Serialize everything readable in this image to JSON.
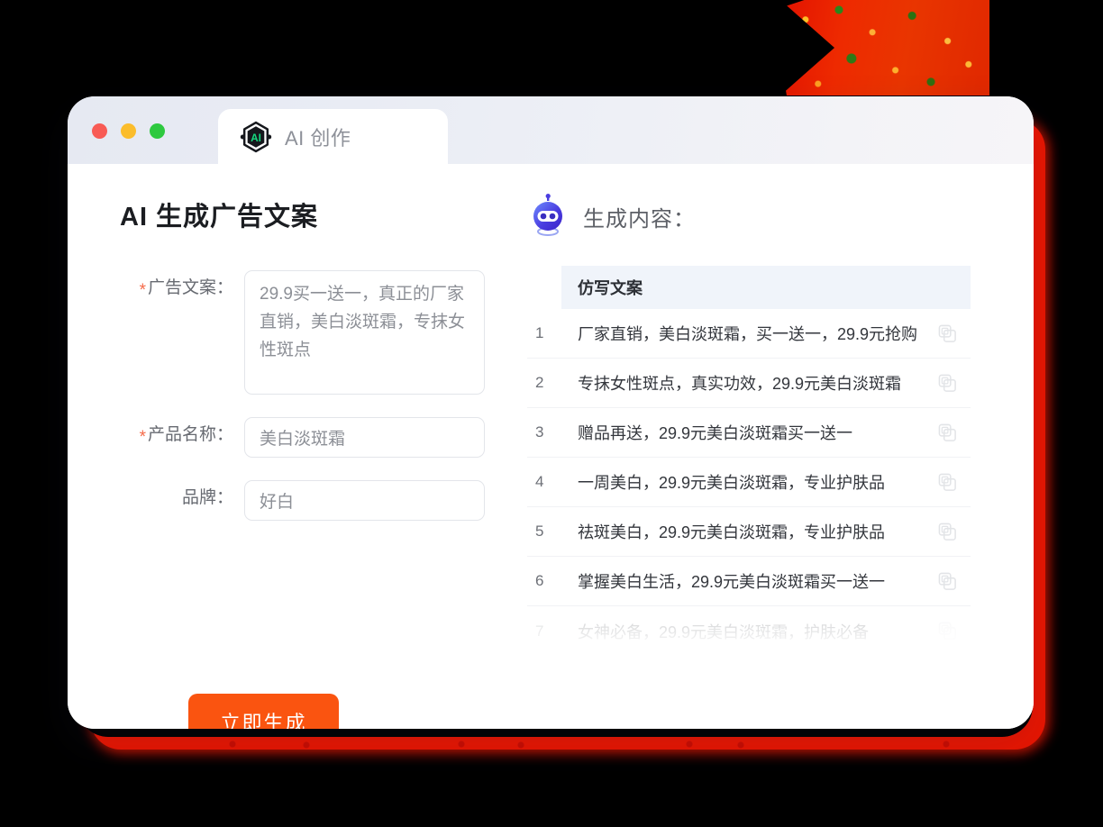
{
  "window": {
    "traffic_lights": [
      {
        "name": "close",
        "color": "#f85b55"
      },
      {
        "name": "minimize",
        "color": "#fbbd2c"
      },
      {
        "name": "maximize",
        "color": "#2ec93f"
      }
    ],
    "tab": {
      "icon": "ai-hexagon-badge-icon",
      "label": "AI 创作"
    }
  },
  "left": {
    "title": "AI 生成广告文案",
    "fields": [
      {
        "label": "广告文案：",
        "required": true,
        "type": "textarea",
        "value": "29.9买一送一，真正的厂家直销，美白淡斑霜，专抹女性斑点"
      },
      {
        "label": "产品名称：",
        "required": true,
        "type": "input",
        "value": "美白淡斑霜"
      },
      {
        "label": "品牌：",
        "required": false,
        "type": "input",
        "value": "好白"
      }
    ],
    "submit_label": "立即生成"
  },
  "right": {
    "icon": "robot-head-icon",
    "title": "生成内容：",
    "table": {
      "header": "仿写文案",
      "row_action_icon": "copy-icon",
      "rows": [
        {
          "num": "1",
          "text": "厂家直销，美白淡斑霜，买一送一，29.9元抢购"
        },
        {
          "num": "2",
          "text": "专抹女性斑点，真实功效，29.9元美白淡斑霜"
        },
        {
          "num": "3",
          "text": "赠品再送，29.9元美白淡斑霜买一送一"
        },
        {
          "num": "4",
          "text": "一周美白，29.9元美白淡斑霜，专业护肤品"
        },
        {
          "num": "5",
          "text": "祛斑美白，29.9元美白淡斑霜，专业护肤品"
        },
        {
          "num": "6",
          "text": "掌握美白生活，29.9元美白淡斑霜买一送一"
        },
        {
          "num": "7",
          "text": "女神必备，29.9元美白淡斑霜，护肤必备"
        }
      ]
    }
  },
  "colors": {
    "accent_orange": "#fa5410",
    "required_star": "#f56b4a",
    "table_header_bg": "#f0f4fa",
    "decoration_red": "#e81500",
    "robot_blue": "#4336d8"
  }
}
